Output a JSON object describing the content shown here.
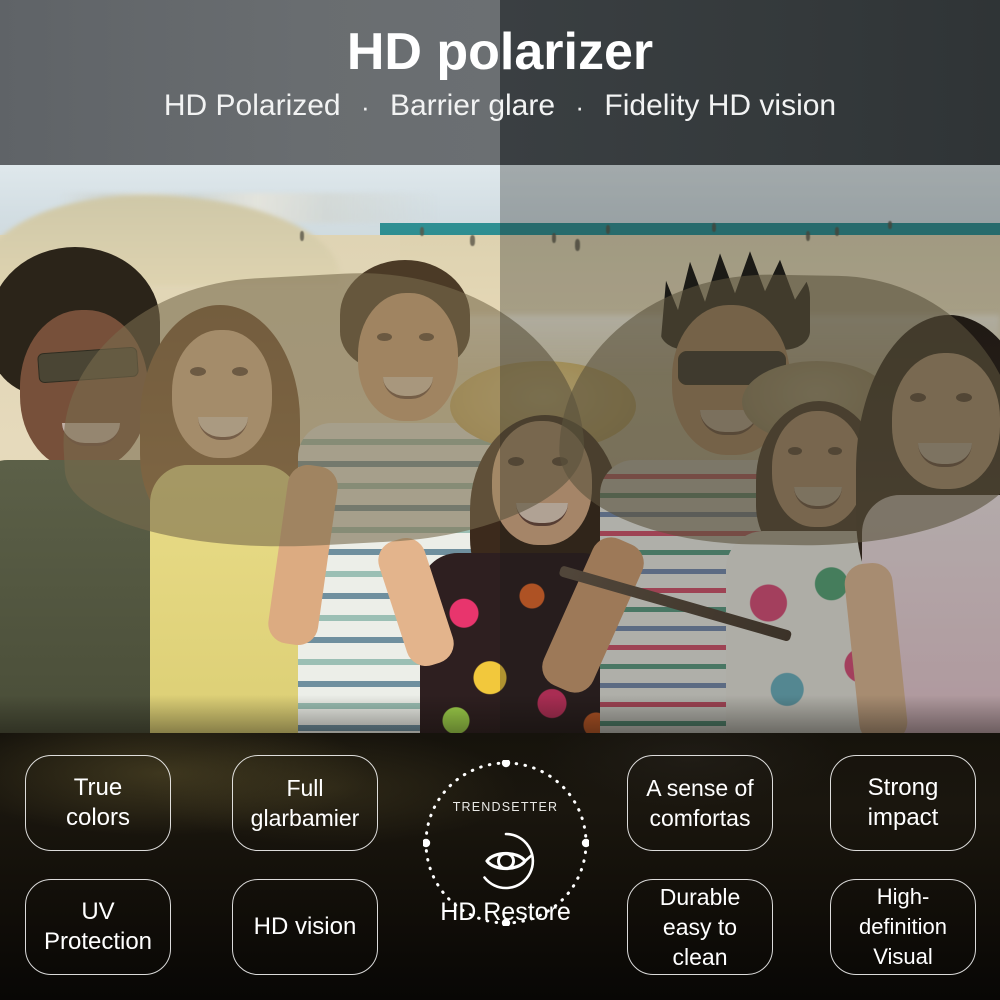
{
  "header": {
    "title": "HD polarizer",
    "subtitle_parts": [
      "HD Polarized",
      "Barrier glare",
      "Fidelity HD vision"
    ],
    "separator": "·",
    "bg_left_color": "#686c6f",
    "bg_right_color": "#33383a",
    "title_color": "#ffffff"
  },
  "photo": {
    "description": "Group of friends taking a beach selfie, left half bright, right half darkened, with polarized lens shapes overlaid",
    "lens_tint_color": "#786a4a"
  },
  "features": {
    "background_color": "#17130c",
    "border_color": "#ffffff",
    "text_color": "#ffffff",
    "chips": [
      {
        "id": "true-colors",
        "label": "True\ncolors",
        "line1": "True",
        "line2": "colors"
      },
      {
        "id": "uv-protection",
        "label": "UV\nProtection",
        "line1": "UV",
        "line2": "Protection"
      },
      {
        "id": "full-glare",
        "label": "Full\nglarbamier",
        "line1": "Full",
        "line2": "glarbamier"
      },
      {
        "id": "hd-vision",
        "label": "HD vision",
        "line1": "HD vision",
        "line2": ""
      },
      {
        "id": "comfort",
        "label": "A sense of\ncomfortas",
        "line1": "A sense of",
        "line2": "comfortas"
      },
      {
        "id": "durable",
        "label": "Durable\neasy to clean",
        "line1": "Durable",
        "line2": "easy to clean"
      },
      {
        "id": "strong-impact",
        "label": "Strong\nimpact",
        "line1": "Strong",
        "line2": "impact"
      },
      {
        "id": "hd-visual",
        "label": "High-definition\nVisual",
        "line1": "High-definition",
        "line2": "Visual"
      }
    ]
  },
  "badge": {
    "brand": "TRENDSETTER",
    "caption": "HD Restore",
    "icon": "eye-icon",
    "ring_style": "dotted-circle"
  }
}
